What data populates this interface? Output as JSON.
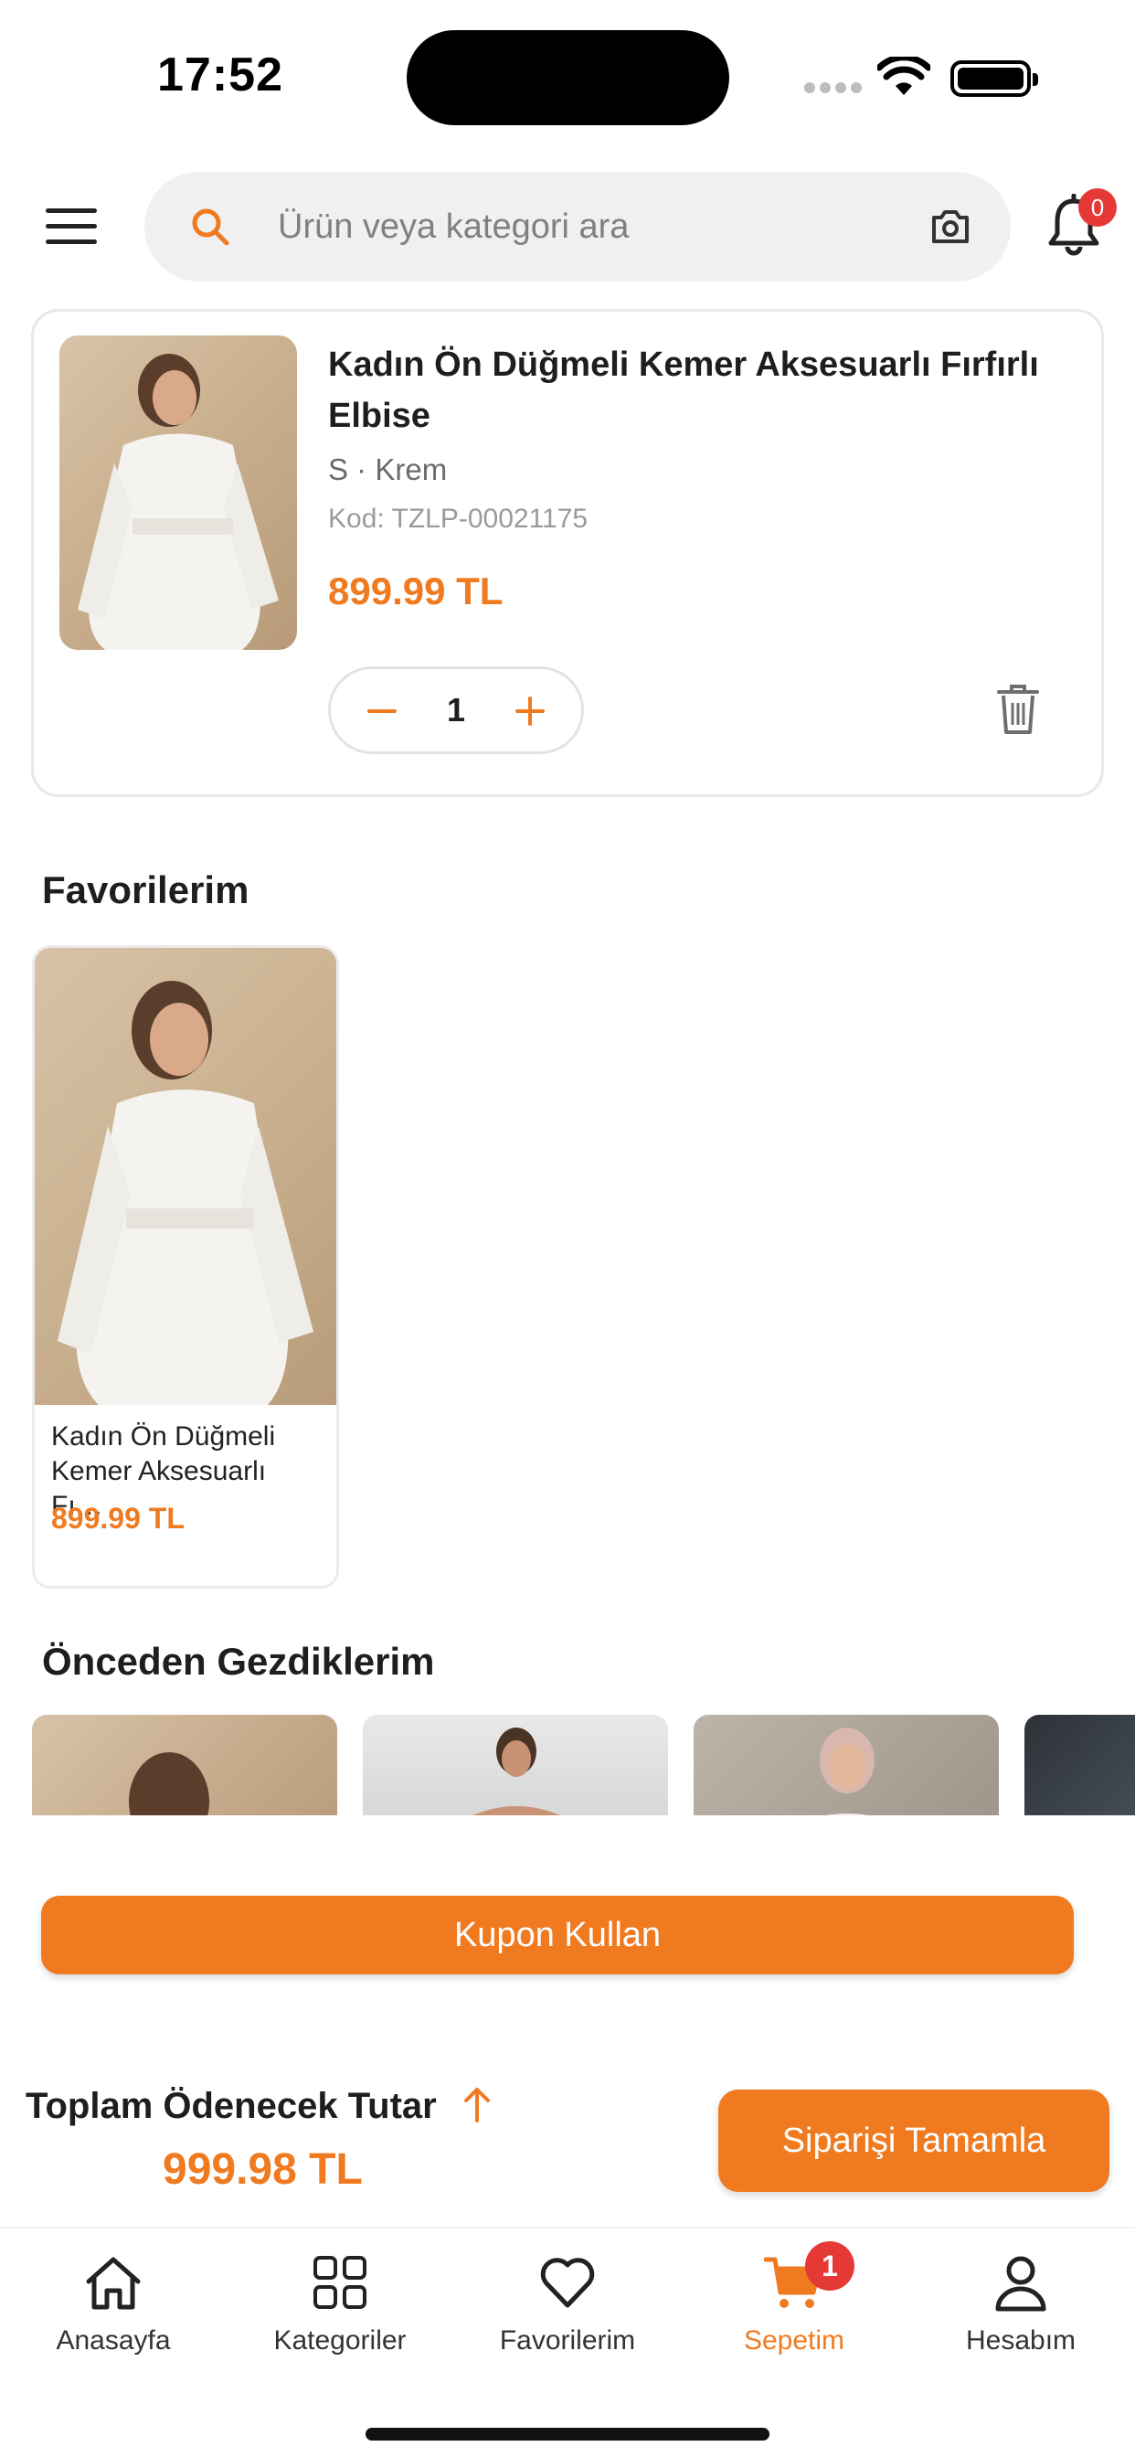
{
  "status_bar": {
    "time": "17:52"
  },
  "search": {
    "placeholder": "Ürün veya kategori ara"
  },
  "notifications": {
    "count": "0"
  },
  "cart_item": {
    "title": "Kadın Ön Düğmeli Kemer Aksesuarlı Fırfırlı Elbise",
    "variant": "S · Krem",
    "code": "Kod: TZLP-00021175",
    "price": "899.99 TL",
    "quantity": "1"
  },
  "favorites": {
    "title": "Favorilerim",
    "items": [
      {
        "name": "Kadın Ön Düğmeli Kemer Aksesuarlı Fı…",
        "price": "899.99 TL"
      }
    ]
  },
  "recently_viewed": {
    "title": "Önceden Gezdiklerim"
  },
  "checkout": {
    "coupon_label": "Kupon Kullan",
    "total_label": "Toplam Ödenecek Tutar",
    "total_amount": "999.98 TL",
    "complete_label": "Siparişi Tamamla"
  },
  "tab_bar": {
    "items": [
      {
        "label": "Anasayfa",
        "icon": "home-icon"
      },
      {
        "label": "Kategoriler",
        "icon": "grid-icon"
      },
      {
        "label": "Favorilerim",
        "icon": "heart-icon"
      },
      {
        "label": "Sepetim",
        "icon": "cart-icon",
        "badge": "1"
      },
      {
        "label": "Hesabım",
        "icon": "user-icon"
      }
    ]
  },
  "colors": {
    "accent": "#f07a1f",
    "badge": "#e53935"
  }
}
